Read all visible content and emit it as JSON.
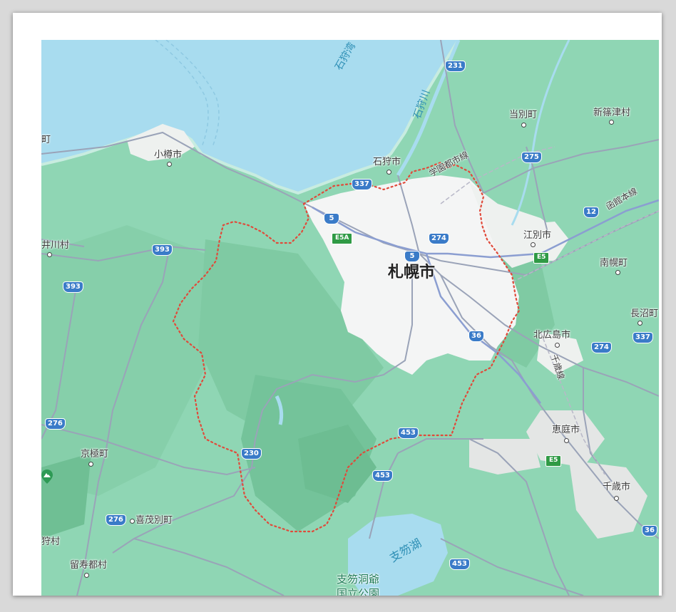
{
  "map": {
    "colors": {
      "land": "#8fd6b4",
      "sea": "#a8dcef",
      "urban": "#f4f5f5",
      "boundary": "#e04a3a"
    },
    "places": {
      "sapporo": "札幌市",
      "otaru": "小樽市",
      "ishikari": "石狩市",
      "tobetsu": "当別町",
      "shinshinotsu": "新篠津村",
      "ebetsu": "江別市",
      "kitahiroshima": "北広島市",
      "eniwa": "恵庭市",
      "chitose": "千歳市",
      "nanporo": "南幌町",
      "naganuma": "長沼町",
      "kyogoku": "京極町",
      "kimobetsu": "喜茂別町",
      "rusutsu": "留寿都村",
      "akaigawa": "井川村",
      "left_edge_1": "町",
      "left_edge_2": "狩村",
      "gakuen": "学園都市線",
      "hakodate_line": "函館本線",
      "chitose_line": "千歳線"
    },
    "water": {
      "ishikari_bay": "石狩湾",
      "ishikari_river": "石狩川",
      "shikotsu_lake": "支笏湖"
    },
    "park": {
      "line1": "支笏洞爺",
      "line2": "国立公園"
    },
    "routes": {
      "r231": "231",
      "r337a": "337",
      "r337b": "337",
      "r5a": "5",
      "r5b": "5",
      "r274a": "274",
      "r274b": "274",
      "r275": "275",
      "r12": "12",
      "r393a": "393",
      "r393b": "393",
      "r36a": "36",
      "r36b": "36",
      "r453a": "453",
      "r453b": "453",
      "r453c": "453",
      "r230": "230",
      "r276a": "276",
      "r276b": "276",
      "e5a": "E5A",
      "e5a2": "E5",
      "e5b": "E5"
    }
  }
}
